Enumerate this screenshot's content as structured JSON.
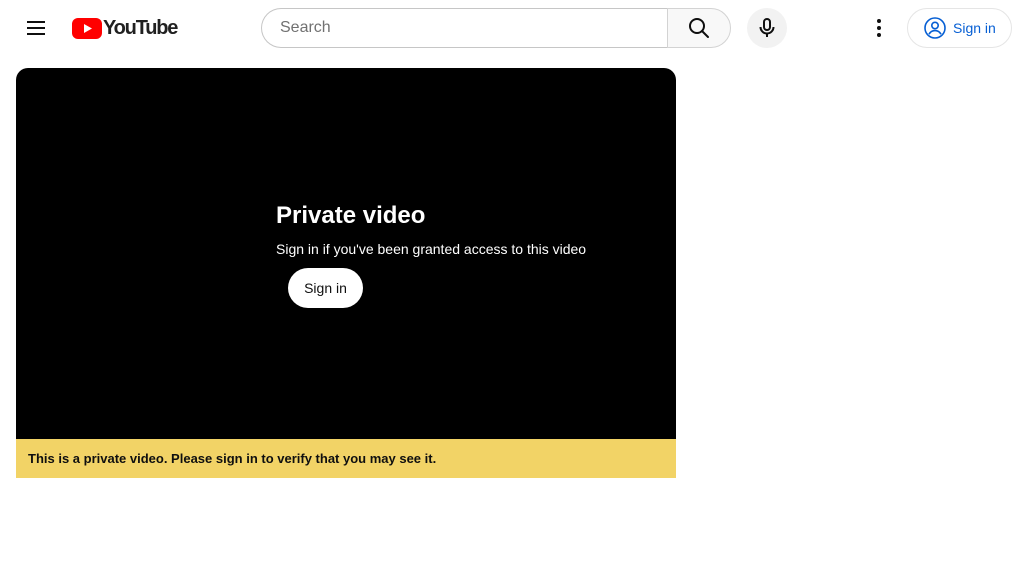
{
  "masthead": {
    "menu_icon": "hamburger-menu-icon",
    "logo_text": "YouTube",
    "logo_color": "#ff0000",
    "search": {
      "placeholder": "Search",
      "value": ""
    },
    "search_icon": "search-icon",
    "voice_icon": "microphone-icon",
    "more_icon": "vertical-dots-icon",
    "signin": {
      "label": "Sign in",
      "icon": "account-circle-icon",
      "color": "#065fd4"
    }
  },
  "player": {
    "title": "Private video",
    "subtitle": "Sign in if you've been granted access to this video",
    "signin_label": "Sign in"
  },
  "banner": {
    "text": "This is a private video. Please sign in to verify that you may see it.",
    "background": "#f2d366"
  }
}
